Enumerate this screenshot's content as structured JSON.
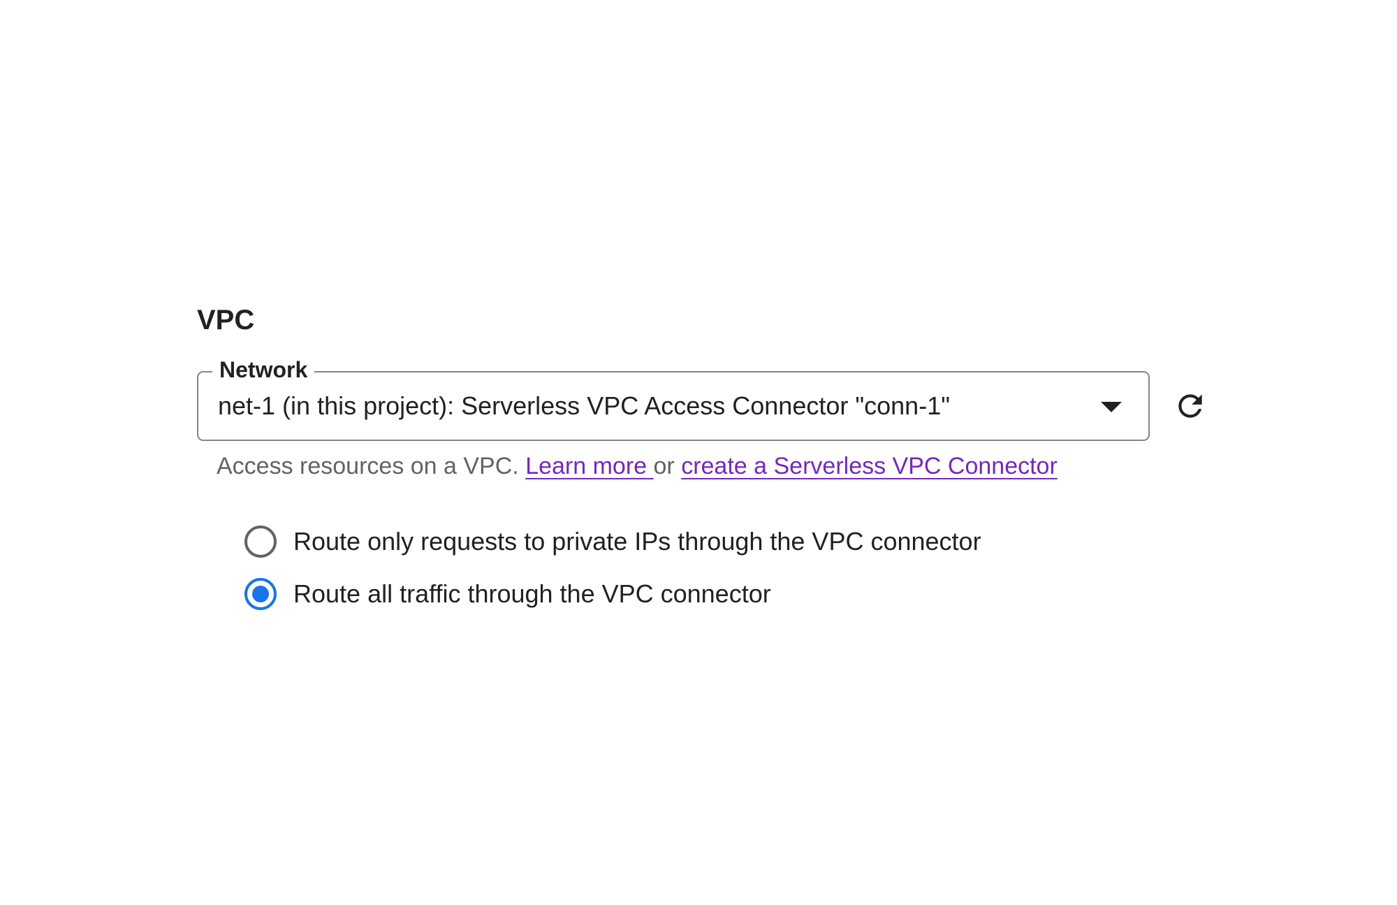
{
  "section": {
    "title": "VPC"
  },
  "network_field": {
    "label": "Network",
    "value": "net-1 (in this project): Serverless VPC Access Connector \"conn-1\""
  },
  "helper": {
    "text": "Access resources on a VPC. ",
    "learn_more": "Learn more ",
    "or": " or ",
    "create_link": "create a Serverless VPC Connector"
  },
  "routing": {
    "options": [
      {
        "label": "Route only requests to private IPs through the VPC connector",
        "selected": false
      },
      {
        "label": "Route all traffic through the VPC connector",
        "selected": true
      }
    ]
  },
  "colors": {
    "accent": "#1a73e8",
    "link": "#7627bb",
    "border": "#80868b",
    "helper_text": "#5f6368"
  },
  "icons": {
    "refresh": "refresh-icon",
    "dropdown": "arrow-drop-down-icon"
  }
}
